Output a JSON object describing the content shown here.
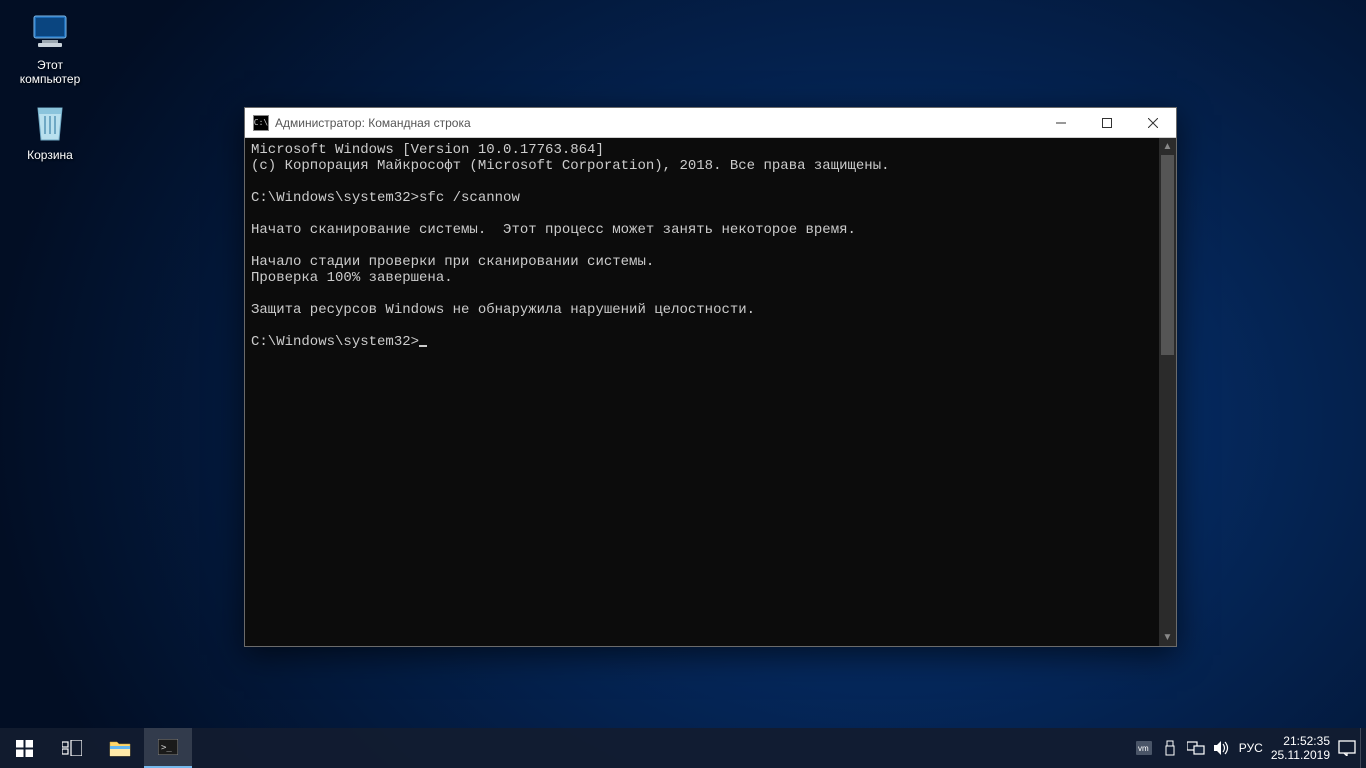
{
  "desktop": {
    "icons": {
      "this_pc": "Этот компьютер",
      "recycle_bin": "Корзина"
    }
  },
  "window": {
    "title": "Администратор: Командная строка",
    "app_icon_text": "C:\\",
    "console_lines": [
      "Microsoft Windows [Version 10.0.17763.864]",
      "(c) Корпорация Майкрософт (Microsoft Corporation), 2018. Все права защищены.",
      "",
      "C:\\Windows\\system32>sfc /scannow",
      "",
      "Начато сканирование системы.  Этот процесс может занять некоторое время.",
      "",
      "Начало стадии проверки при сканировании системы.",
      "Проверка 100% завершена.",
      "",
      "Защита ресурсов Windows не обнаружила нарушений целостности.",
      "",
      "C:\\Windows\\system32>"
    ]
  },
  "taskbar": {
    "lang": "РУС",
    "time": "21:52:35",
    "date": "25.11.2019"
  }
}
